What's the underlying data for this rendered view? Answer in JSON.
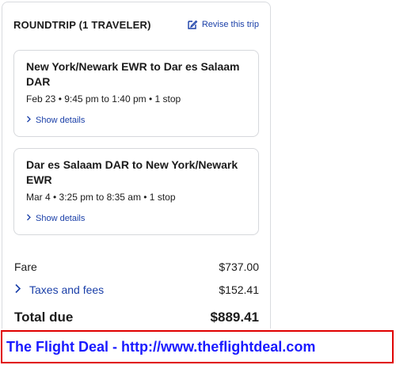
{
  "trip": {
    "label": "ROUNDTRIP (1 TRAVELER)",
    "revise_label": "Revise this trip"
  },
  "segments": [
    {
      "route": "New York/Newark EWR to Dar es Salaam DAR",
      "times": "Feb 23 • 9:45 pm to 1:40 pm • 1 stop",
      "details_label": "Show details"
    },
    {
      "route": "Dar es Salaam DAR to New York/Newark EWR",
      "times": "Mar 4 • 3:25 pm to 8:35 am • 1 stop",
      "details_label": "Show details"
    }
  ],
  "pricing": {
    "fare_label": "Fare",
    "fare_value": "$737.00",
    "taxes_label": "Taxes and fees",
    "taxes_value": "$152.41",
    "total_label": "Total due",
    "total_value": "$889.41"
  },
  "footer": {
    "text": "The Flight Deal - http://www.theflightdeal.com"
  },
  "colors": {
    "link": "#1a3fa8",
    "banner_border": "#e00000",
    "banner_text": "#1a1aff"
  },
  "icons": {
    "revise": "edit-icon",
    "details": "chevron-right-icon"
  }
}
